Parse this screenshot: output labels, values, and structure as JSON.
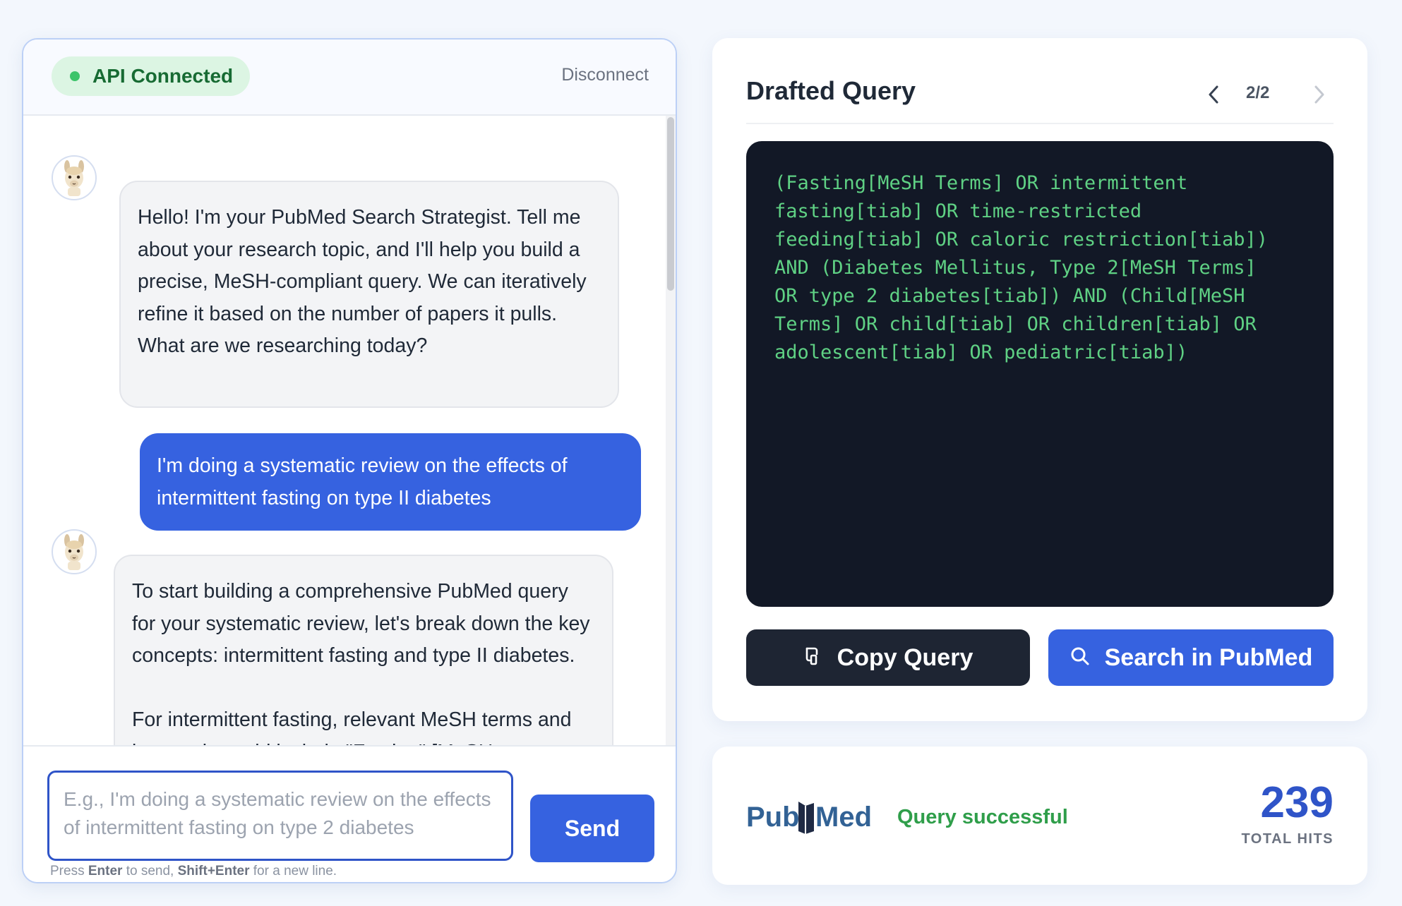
{
  "chat": {
    "status": "API Connected",
    "disconnect_label": "Disconnect",
    "messages": [
      {
        "role": "assistant",
        "text": "Hello! I'm your PubMed Search Strategist. Tell me about your research topic, and I'll help you build a precise, MeSH-compliant query. We can iteratively refine it based on the number of papers it pulls. What are we researching today?"
      },
      {
        "role": "user",
        "text": "I'm doing a systematic review on the effects of intermittent fasting on type II diabetes"
      },
      {
        "role": "assistant",
        "text": "To start building a comprehensive PubMed query for your systematic review, let's break down the key concepts: intermittent fasting and type II diabetes.\n\nFor intermittent fasting, relevant MeSH terms and keywords could include \"Fasting\" [MeSH"
      }
    ],
    "input_placeholder": "E.g., I'm doing a systematic review on the effects of intermittent fasting on type 2 diabetes",
    "send_label": "Send",
    "hint": {
      "press": "Press",
      "key1": "Enter",
      "mid": "to send,",
      "key2": "Shift+Enter",
      "end": "for a new line."
    }
  },
  "query_panel": {
    "title": "Drafted Query",
    "page_indicator": "2/2",
    "query_text": "(Fasting[MeSH Terms] OR intermittent\nfasting[tiab] OR time-restricted\nfeeding[tiab] OR caloric restriction[tiab])\nAND (Diabetes Mellitus, Type 2[MeSH Terms]\nOR type 2 diabetes[tiab]) AND (Child[MeSH\nTerms] OR child[tiab] OR children[tiab] OR\nadolescent[tiab] OR pediatric[tiab])",
    "copy_label": "Copy Query",
    "search_label": "Search in PubMed"
  },
  "results": {
    "logo_text": "PubMed",
    "status": "Query successful",
    "count": "239",
    "count_label": "TOTAL HITS"
  },
  "colors": {
    "accent": "#3662e0",
    "code_bg": "#121826",
    "code_text": "#5fd184",
    "success": "#2f9e4a",
    "status_badge_bg": "#dcf5e3"
  },
  "icons": {
    "avatar": "llama-avatar-icon",
    "status": "status-dot-icon",
    "prev": "chevron-left-icon",
    "next": "chevron-right-icon",
    "copy": "clipboard-icon",
    "search": "search-icon"
  }
}
